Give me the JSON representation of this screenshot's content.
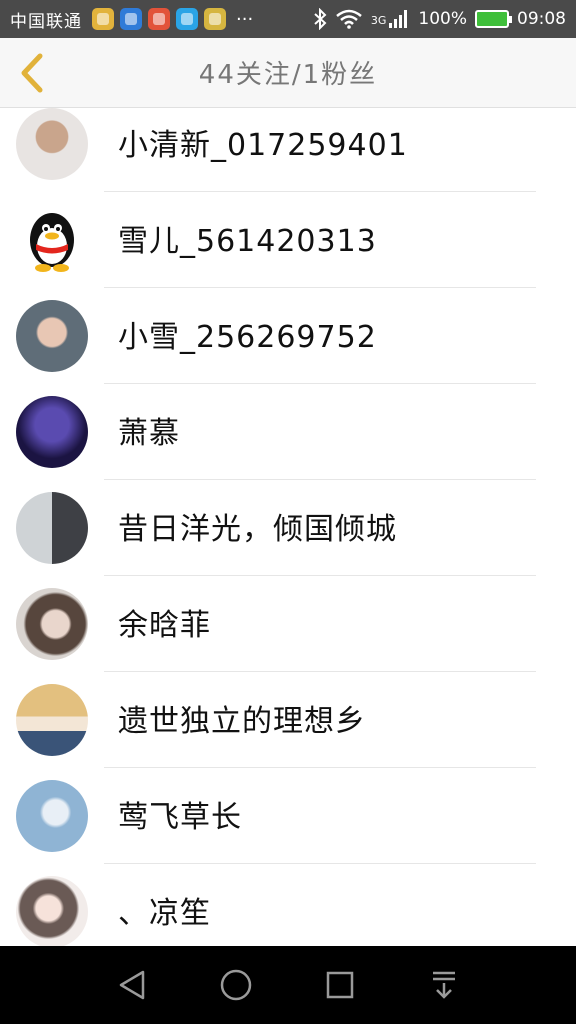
{
  "status_bar": {
    "carrier": "中国联通",
    "dots": "···",
    "network": "3G",
    "battery_percent": "100%",
    "time": "09:08"
  },
  "header": {
    "title": "44关注/1粉丝"
  },
  "list": {
    "items": [
      {
        "name": "小清新_017259401",
        "avatar_colors": [
          "#e8e4e2",
          "#c9a58c"
        ]
      },
      {
        "name": "雪儿_561420313",
        "avatar_colors": [
          "#ffffff",
          "#111111"
        ]
      },
      {
        "name": "小雪_256269752",
        "avatar_colors": [
          "#5f6d78",
          "#e8c7b4"
        ]
      },
      {
        "name": "萧慕",
        "avatar_colors": [
          "#1b1442",
          "#5a4bb0"
        ]
      },
      {
        "name": "昔日洋光，倾国倾城",
        "avatar_colors": [
          "#cfd3d6",
          "#3e4045"
        ]
      },
      {
        "name": "余晗菲",
        "avatar_colors": [
          "#d9d4d0",
          "#57463d"
        ]
      },
      {
        "name": "遗世独立的理想乡",
        "avatar_colors": [
          "#e3c07f",
          "#3a5478"
        ]
      },
      {
        "name": "莺飞草长",
        "avatar_colors": [
          "#8fb4d4",
          "#e8eff6"
        ]
      },
      {
        "name": "、凉笙",
        "avatar_colors": [
          "#f2ecea",
          "#6a5a55"
        ]
      }
    ]
  },
  "colors": {
    "status_bar_bg": "#4a4a4a",
    "header_bg": "#f7f7f7",
    "back_icon": "#e1b23a",
    "nav_bar_bg": "#000000"
  }
}
